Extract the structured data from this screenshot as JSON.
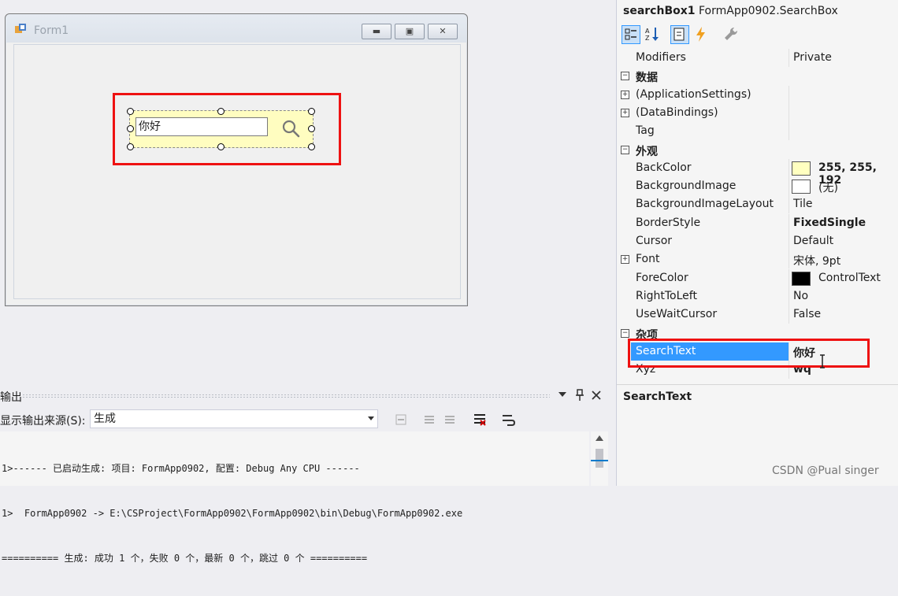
{
  "designer": {
    "form_title": "Form1",
    "search_box_text": "你好"
  },
  "output": {
    "title": "输出",
    "source_label": "显示输出来源(S):",
    "source_value": "生成",
    "lines": [
      "1>------ 已启动生成: 项目: FormApp0902, 配置: Debug Any CPU ------",
      "1>  FormApp0902 -> E:\\CSProject\\FormApp0902\\FormApp0902\\bin\\Debug\\FormApp0902.exe",
      "========== 生成: 成功 1 个，失败 0 个，最新 0 个，跳过 0 个 =========="
    ]
  },
  "properties": {
    "object_name": "searchBox1",
    "object_type": "FormApp0902.SearchBox",
    "rows": [
      {
        "name": "Modifiers",
        "value": "Private",
        "kind": "prop"
      },
      {
        "name": "数据",
        "value": "",
        "kind": "cat"
      },
      {
        "name": "(ApplicationSettings)",
        "value": "",
        "kind": "expand"
      },
      {
        "name": "(DataBindings)",
        "value": "",
        "kind": "expand"
      },
      {
        "name": "Tag",
        "value": "",
        "kind": "prop"
      },
      {
        "name": "外观",
        "value": "",
        "kind": "cat"
      },
      {
        "name": "BackColor",
        "value": "255, 255, 192",
        "kind": "color",
        "color": "#ffffc0",
        "bold": true
      },
      {
        "name": "BackgroundImage",
        "value": "(无)",
        "kind": "color",
        "color": "#ffffff"
      },
      {
        "name": "BackgroundImageLayout",
        "value": "Tile",
        "kind": "prop"
      },
      {
        "name": "BorderStyle",
        "value": "FixedSingle",
        "kind": "prop",
        "bold": true
      },
      {
        "name": "Cursor",
        "value": "Default",
        "kind": "prop"
      },
      {
        "name": "Font",
        "value": "宋体, 9pt",
        "kind": "expand"
      },
      {
        "name": "ForeColor",
        "value": "ControlText",
        "kind": "color",
        "color": "#000000"
      },
      {
        "name": "RightToLeft",
        "value": "No",
        "kind": "prop"
      },
      {
        "name": "UseWaitCursor",
        "value": "False",
        "kind": "prop"
      },
      {
        "name": "杂项",
        "value": "",
        "kind": "cat"
      },
      {
        "name": "SearchText",
        "value": "你好",
        "kind": "prop",
        "bold": true,
        "selected": true
      },
      {
        "name": "Xyz",
        "value": "wq",
        "kind": "prop",
        "bold": true
      }
    ],
    "description_title": "SearchText"
  },
  "watermark": "CSDN @Pual singer",
  "colors": {
    "highlight": "#e11111",
    "selection": "#3399ff",
    "search_back": "#ffffc0"
  }
}
